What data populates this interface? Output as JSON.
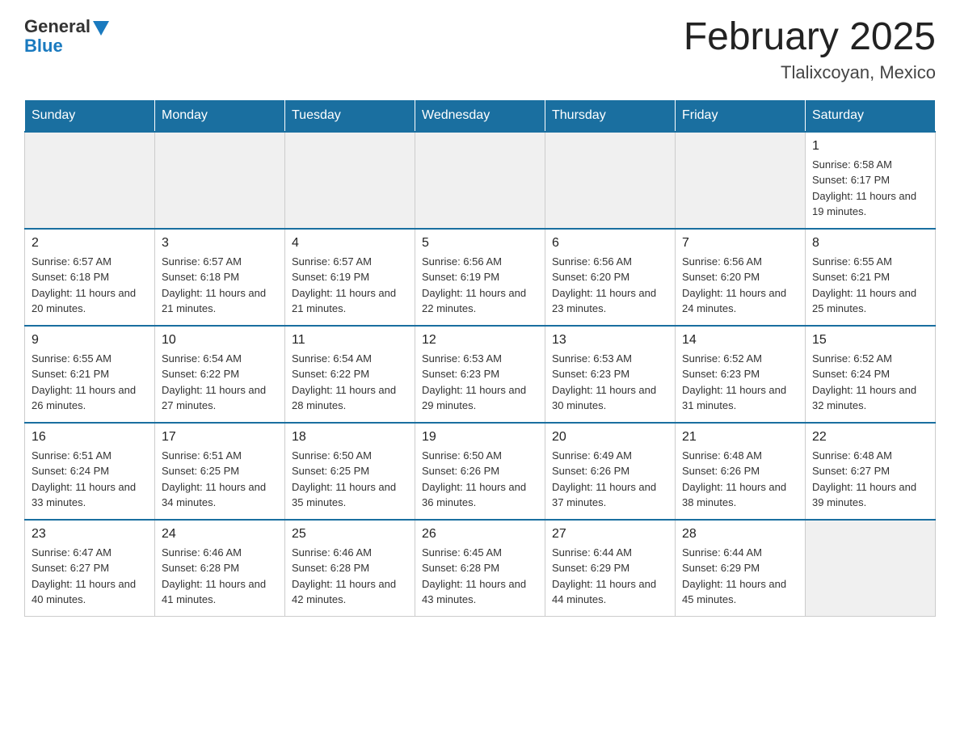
{
  "header": {
    "logo_general": "General",
    "logo_blue": "Blue",
    "month_title": "February 2025",
    "location": "Tlalixcoyan, Mexico"
  },
  "days_of_week": [
    "Sunday",
    "Monday",
    "Tuesday",
    "Wednesday",
    "Thursday",
    "Friday",
    "Saturday"
  ],
  "weeks": [
    [
      {
        "day": "",
        "sunrise": "",
        "sunset": "",
        "daylight": "",
        "empty": true
      },
      {
        "day": "",
        "sunrise": "",
        "sunset": "",
        "daylight": "",
        "empty": true
      },
      {
        "day": "",
        "sunrise": "",
        "sunset": "",
        "daylight": "",
        "empty": true
      },
      {
        "day": "",
        "sunrise": "",
        "sunset": "",
        "daylight": "",
        "empty": true
      },
      {
        "day": "",
        "sunrise": "",
        "sunset": "",
        "daylight": "",
        "empty": true
      },
      {
        "day": "",
        "sunrise": "",
        "sunset": "",
        "daylight": "",
        "empty": true
      },
      {
        "day": "1",
        "sunrise": "Sunrise: 6:58 AM",
        "sunset": "Sunset: 6:17 PM",
        "daylight": "Daylight: 11 hours and 19 minutes.",
        "empty": false
      }
    ],
    [
      {
        "day": "2",
        "sunrise": "Sunrise: 6:57 AM",
        "sunset": "Sunset: 6:18 PM",
        "daylight": "Daylight: 11 hours and 20 minutes.",
        "empty": false
      },
      {
        "day": "3",
        "sunrise": "Sunrise: 6:57 AM",
        "sunset": "Sunset: 6:18 PM",
        "daylight": "Daylight: 11 hours and 21 minutes.",
        "empty": false
      },
      {
        "day": "4",
        "sunrise": "Sunrise: 6:57 AM",
        "sunset": "Sunset: 6:19 PM",
        "daylight": "Daylight: 11 hours and 21 minutes.",
        "empty": false
      },
      {
        "day": "5",
        "sunrise": "Sunrise: 6:56 AM",
        "sunset": "Sunset: 6:19 PM",
        "daylight": "Daylight: 11 hours and 22 minutes.",
        "empty": false
      },
      {
        "day": "6",
        "sunrise": "Sunrise: 6:56 AM",
        "sunset": "Sunset: 6:20 PM",
        "daylight": "Daylight: 11 hours and 23 minutes.",
        "empty": false
      },
      {
        "day": "7",
        "sunrise": "Sunrise: 6:56 AM",
        "sunset": "Sunset: 6:20 PM",
        "daylight": "Daylight: 11 hours and 24 minutes.",
        "empty": false
      },
      {
        "day": "8",
        "sunrise": "Sunrise: 6:55 AM",
        "sunset": "Sunset: 6:21 PM",
        "daylight": "Daylight: 11 hours and 25 minutes.",
        "empty": false
      }
    ],
    [
      {
        "day": "9",
        "sunrise": "Sunrise: 6:55 AM",
        "sunset": "Sunset: 6:21 PM",
        "daylight": "Daylight: 11 hours and 26 minutes.",
        "empty": false
      },
      {
        "day": "10",
        "sunrise": "Sunrise: 6:54 AM",
        "sunset": "Sunset: 6:22 PM",
        "daylight": "Daylight: 11 hours and 27 minutes.",
        "empty": false
      },
      {
        "day": "11",
        "sunrise": "Sunrise: 6:54 AM",
        "sunset": "Sunset: 6:22 PM",
        "daylight": "Daylight: 11 hours and 28 minutes.",
        "empty": false
      },
      {
        "day": "12",
        "sunrise": "Sunrise: 6:53 AM",
        "sunset": "Sunset: 6:23 PM",
        "daylight": "Daylight: 11 hours and 29 minutes.",
        "empty": false
      },
      {
        "day": "13",
        "sunrise": "Sunrise: 6:53 AM",
        "sunset": "Sunset: 6:23 PM",
        "daylight": "Daylight: 11 hours and 30 minutes.",
        "empty": false
      },
      {
        "day": "14",
        "sunrise": "Sunrise: 6:52 AM",
        "sunset": "Sunset: 6:23 PM",
        "daylight": "Daylight: 11 hours and 31 minutes.",
        "empty": false
      },
      {
        "day": "15",
        "sunrise": "Sunrise: 6:52 AM",
        "sunset": "Sunset: 6:24 PM",
        "daylight": "Daylight: 11 hours and 32 minutes.",
        "empty": false
      }
    ],
    [
      {
        "day": "16",
        "sunrise": "Sunrise: 6:51 AM",
        "sunset": "Sunset: 6:24 PM",
        "daylight": "Daylight: 11 hours and 33 minutes.",
        "empty": false
      },
      {
        "day": "17",
        "sunrise": "Sunrise: 6:51 AM",
        "sunset": "Sunset: 6:25 PM",
        "daylight": "Daylight: 11 hours and 34 minutes.",
        "empty": false
      },
      {
        "day": "18",
        "sunrise": "Sunrise: 6:50 AM",
        "sunset": "Sunset: 6:25 PM",
        "daylight": "Daylight: 11 hours and 35 minutes.",
        "empty": false
      },
      {
        "day": "19",
        "sunrise": "Sunrise: 6:50 AM",
        "sunset": "Sunset: 6:26 PM",
        "daylight": "Daylight: 11 hours and 36 minutes.",
        "empty": false
      },
      {
        "day": "20",
        "sunrise": "Sunrise: 6:49 AM",
        "sunset": "Sunset: 6:26 PM",
        "daylight": "Daylight: 11 hours and 37 minutes.",
        "empty": false
      },
      {
        "day": "21",
        "sunrise": "Sunrise: 6:48 AM",
        "sunset": "Sunset: 6:26 PM",
        "daylight": "Daylight: 11 hours and 38 minutes.",
        "empty": false
      },
      {
        "day": "22",
        "sunrise": "Sunrise: 6:48 AM",
        "sunset": "Sunset: 6:27 PM",
        "daylight": "Daylight: 11 hours and 39 minutes.",
        "empty": false
      }
    ],
    [
      {
        "day": "23",
        "sunrise": "Sunrise: 6:47 AM",
        "sunset": "Sunset: 6:27 PM",
        "daylight": "Daylight: 11 hours and 40 minutes.",
        "empty": false
      },
      {
        "day": "24",
        "sunrise": "Sunrise: 6:46 AM",
        "sunset": "Sunset: 6:28 PM",
        "daylight": "Daylight: 11 hours and 41 minutes.",
        "empty": false
      },
      {
        "day": "25",
        "sunrise": "Sunrise: 6:46 AM",
        "sunset": "Sunset: 6:28 PM",
        "daylight": "Daylight: 11 hours and 42 minutes.",
        "empty": false
      },
      {
        "day": "26",
        "sunrise": "Sunrise: 6:45 AM",
        "sunset": "Sunset: 6:28 PM",
        "daylight": "Daylight: 11 hours and 43 minutes.",
        "empty": false
      },
      {
        "day": "27",
        "sunrise": "Sunrise: 6:44 AM",
        "sunset": "Sunset: 6:29 PM",
        "daylight": "Daylight: 11 hours and 44 minutes.",
        "empty": false
      },
      {
        "day": "28",
        "sunrise": "Sunrise: 6:44 AM",
        "sunset": "Sunset: 6:29 PM",
        "daylight": "Daylight: 11 hours and 45 minutes.",
        "empty": false
      },
      {
        "day": "",
        "sunrise": "",
        "sunset": "",
        "daylight": "",
        "empty": true
      }
    ]
  ]
}
